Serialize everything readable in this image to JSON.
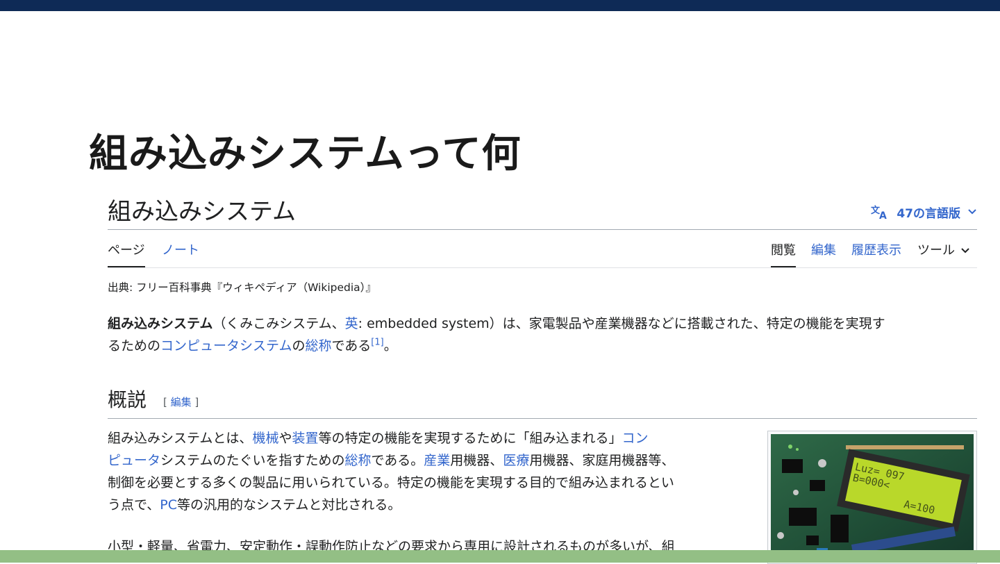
{
  "slide": {
    "title": "組み込みシステムって何"
  },
  "article": {
    "title": "組み込みシステム",
    "languages_label": "47の言語版"
  },
  "tabs": {
    "page": "ページ",
    "talk": "ノート",
    "read": "閲覧",
    "edit": "編集",
    "history": "履歴表示",
    "tools": "ツール"
  },
  "from_line": "出典: フリー百科事典『ウィキペディア（Wikipedia）』",
  "intro": {
    "bold": "組み込みシステム",
    "t1": "（くみこみシステム、",
    "link_en": "英",
    "t2": ": embedded system）は、家電製品や産業機器などに搭載された、特定の機能を実現す",
    "t3": "るための",
    "link_computer_system": "コンピュータシステム",
    "t4": "の",
    "link_generic_name": "総称",
    "t5": "である",
    "ref": "[1]",
    "t6": "。"
  },
  "section": {
    "title": "概説",
    "edit_open": "[ ",
    "edit_label": "編集",
    "edit_close": " ]"
  },
  "overview": {
    "t1": "組み込みシステムとは、",
    "link_machine": "機械",
    "t2": "や",
    "link_device": "装置",
    "t3": "等の特定の機能を実現するために「組み込まれる」",
    "link_computer_a": "コン",
    "link_computer_b": "ピュータ",
    "t4": "システムのたぐいを指すための",
    "link_generic_name": "総称",
    "t5": "である。",
    "link_industry": "産業",
    "t6": "用機器、",
    "link_medical": "医療",
    "t7": "用機器、家庭用機器等、",
    "t8": "制御を必要とする多くの製品に用いられている。特定の機能を実現する目的で組み込まれるとい",
    "t9": "う点で、",
    "link_pc": "PC",
    "t10": "等の汎用的なシステムと対比される。"
  },
  "overview2": {
    "text": "小型・軽量、省電力、安定動作・誤動作防止などの要求から専用に設計されるものが多いが、組"
  },
  "lcd": {
    "line1": "Luz= 097",
    "line2": "B=000<",
    "line3": "A=100"
  },
  "colors": {
    "link": "#3366cc",
    "top_bar": "#0e2a56",
    "bottom_bar": "#93bf85"
  }
}
